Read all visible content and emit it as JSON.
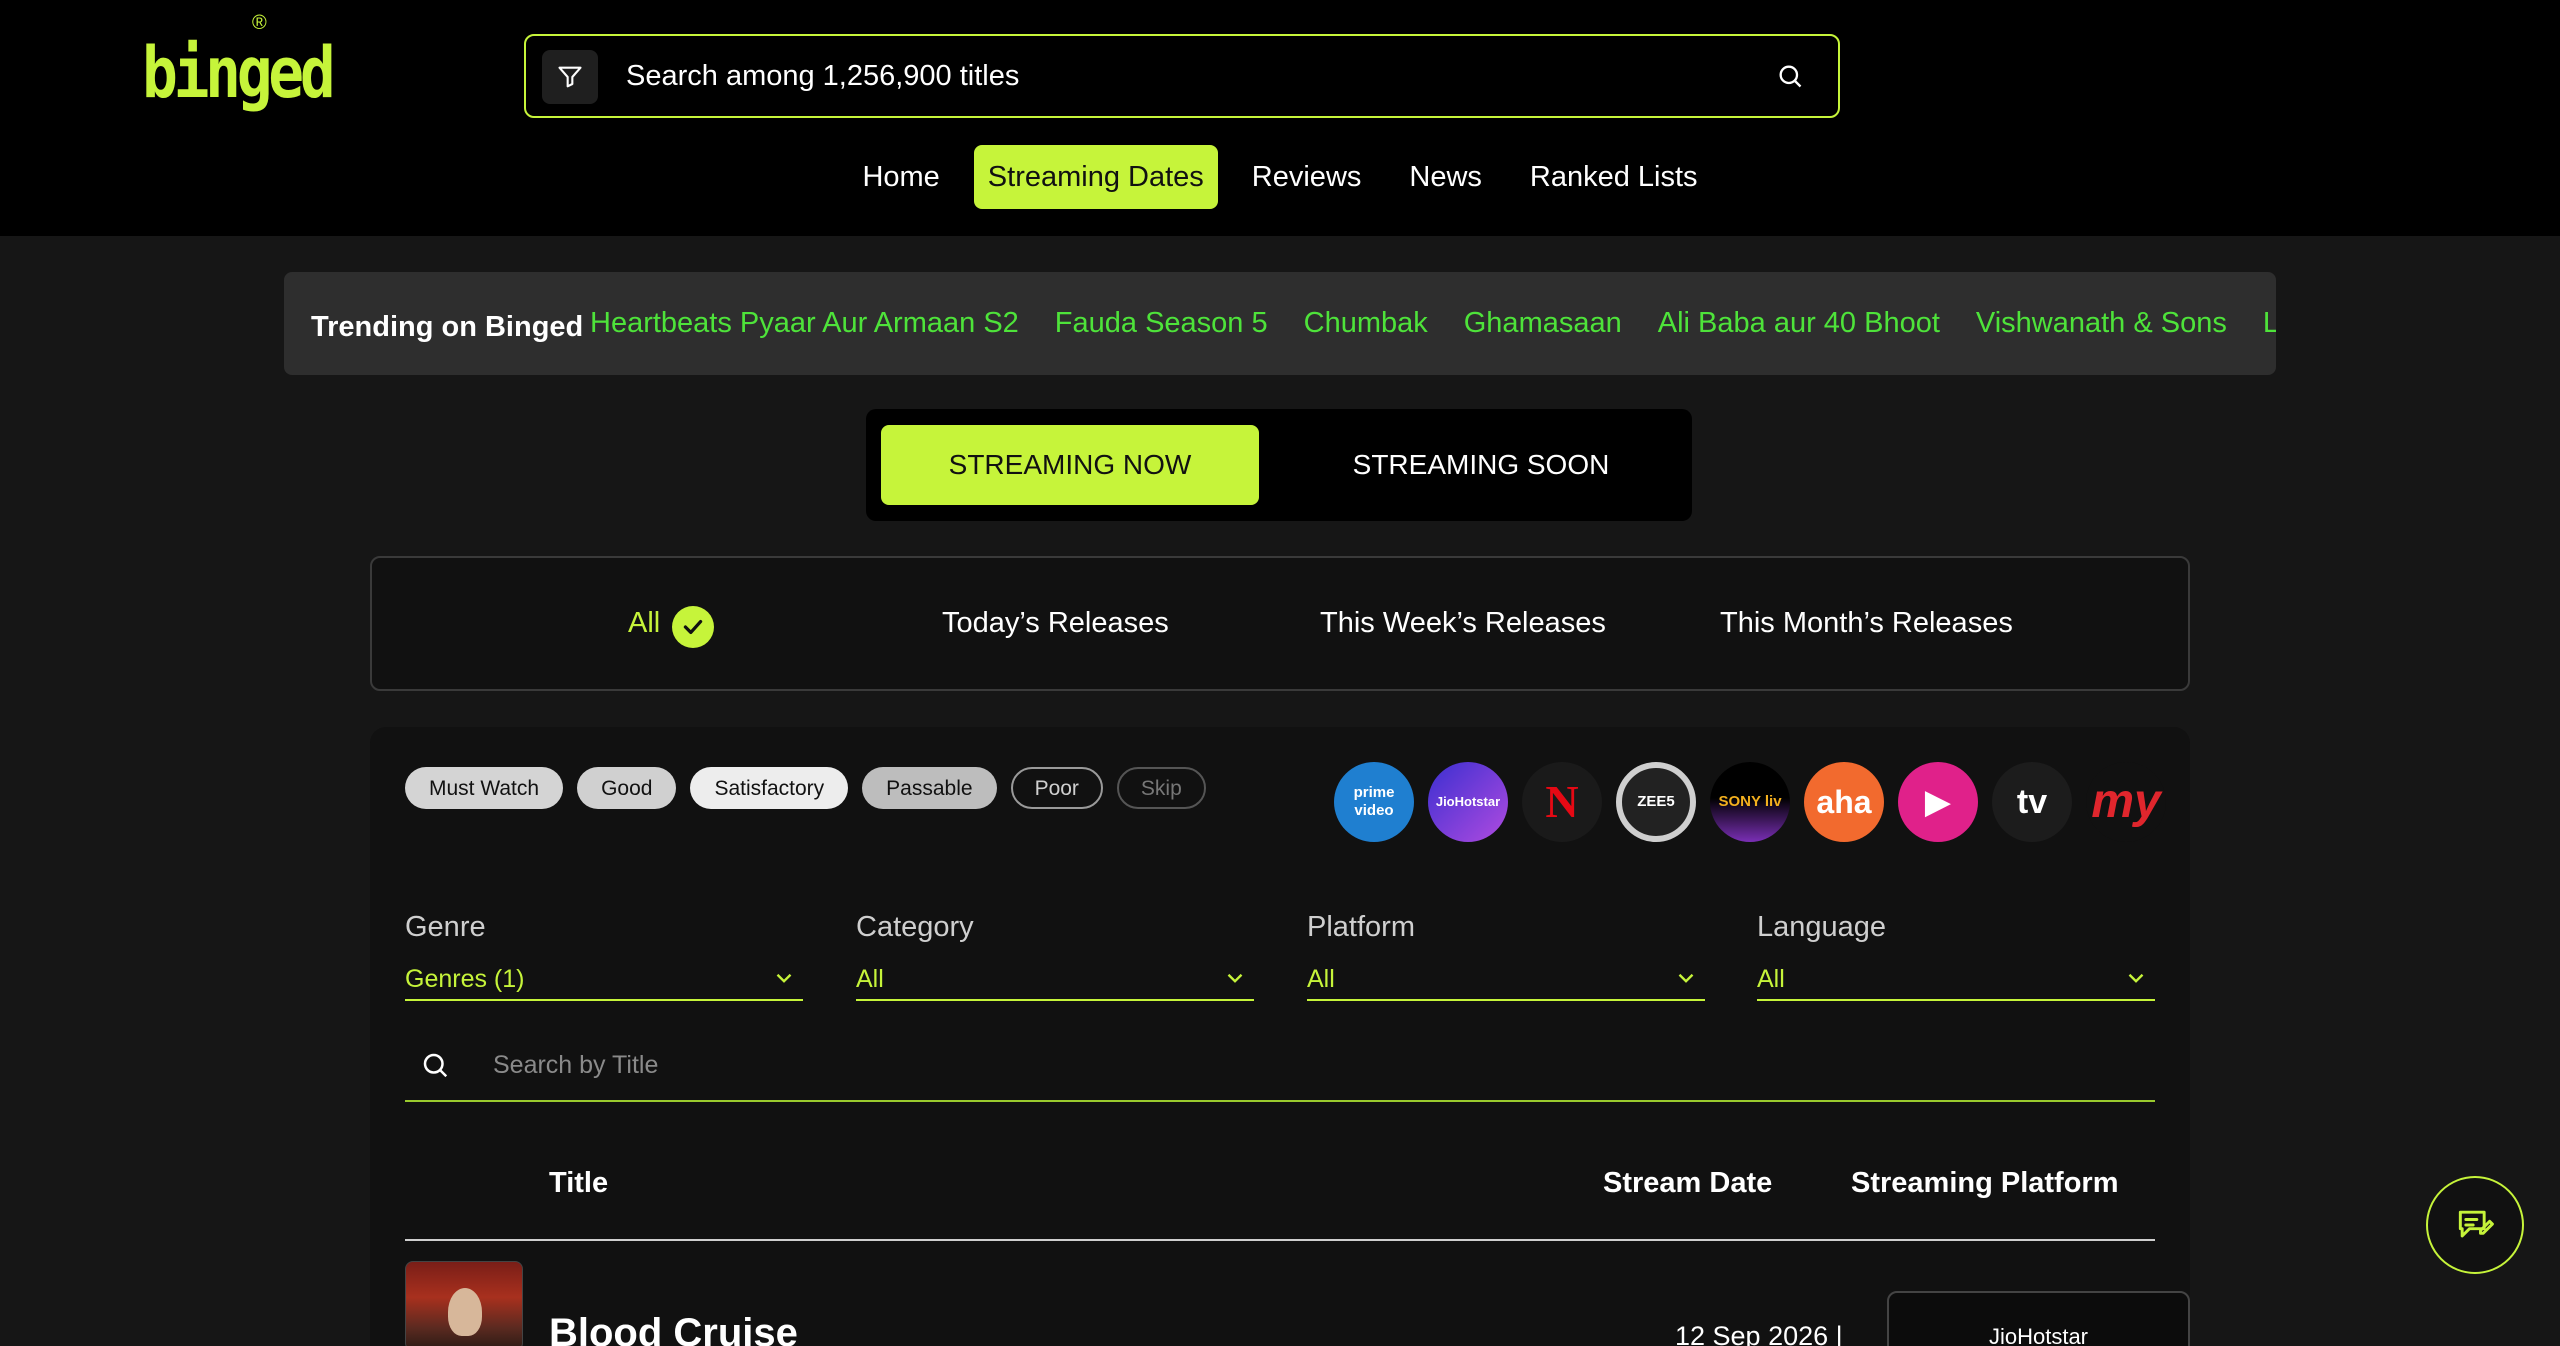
{
  "brand": {
    "logo_text": "binged",
    "registered_mark": "®",
    "accent_color": "#c6f43a"
  },
  "search": {
    "placeholder": "Search among 1,256,900 titles",
    "filter_icon": "filter-icon",
    "submit_icon": "search-icon"
  },
  "nav": {
    "items": [
      {
        "label": "Home",
        "active": false
      },
      {
        "label": "Streaming Dates",
        "active": true
      },
      {
        "label": "Reviews",
        "active": false
      },
      {
        "label": "News",
        "active": false
      },
      {
        "label": "Ranked Lists",
        "active": false
      }
    ]
  },
  "trending": {
    "label": "Trending on Binged",
    "items": [
      "Heartbeats Pyaar Aur Armaan S2",
      "Fauda Season 5",
      "Chumbak",
      "Ghamasaan",
      "Ali Baba aur 40 Bhoot",
      "Vishwanath & Sons",
      "Last"
    ],
    "color": "#4ee33a"
  },
  "stream_toggle": {
    "now_label": "STREAMING NOW",
    "soon_label": "STREAMING SOON",
    "selected": "now"
  },
  "periods": {
    "items": [
      "All",
      "Today’s Releases",
      "This Week’s Releases",
      "This Month’s Releases"
    ],
    "selected": "All"
  },
  "verdict_chips": [
    "Must Watch",
    "Good",
    "Satisfactory",
    "Passable",
    "Poor",
    "Skip"
  ],
  "platforms": [
    {
      "name": "prime-video",
      "label": "prime video"
    },
    {
      "name": "jiohotstar",
      "label": "JioHotstar"
    },
    {
      "name": "netflix",
      "label": "N"
    },
    {
      "name": "zee5",
      "label": "ZEE5"
    },
    {
      "name": "sony-liv",
      "label": "SONY liv"
    },
    {
      "name": "aha",
      "label": "aha"
    },
    {
      "name": "jiocinema",
      "label": "▶"
    },
    {
      "name": "apple-tv",
      "label": "tv"
    },
    {
      "name": "mx-player",
      "label": "my"
    }
  ],
  "filters": [
    {
      "label": "Genre",
      "value": "Genres (1)"
    },
    {
      "label": "Category",
      "value": "All"
    },
    {
      "label": "Platform",
      "value": "All"
    },
    {
      "label": "Language",
      "value": "All"
    }
  ],
  "title_search": {
    "placeholder": "Search by Title"
  },
  "table": {
    "headers": {
      "title": "Title",
      "stream_date": "Stream Date",
      "platform": "Streaming Platform"
    },
    "rows": [
      {
        "title": "Blood Cruise",
        "stream_date": "12 Sep 2026 |",
        "platform": "JioHotstar"
      }
    ]
  },
  "feedback": {
    "icon": "feedback-icon"
  }
}
